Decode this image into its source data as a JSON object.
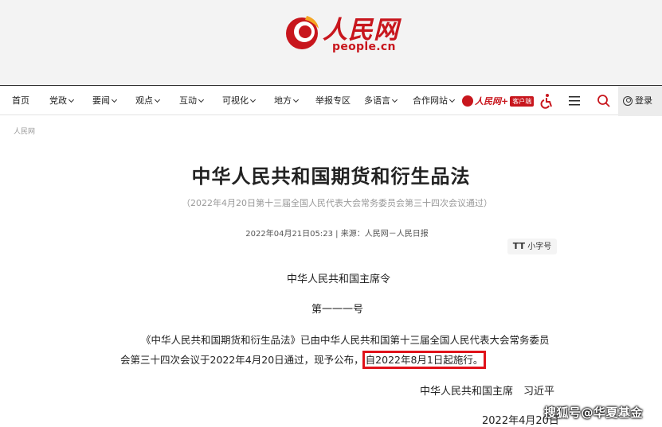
{
  "site": {
    "logo_cn": "人民网",
    "logo_url": "people.cn",
    "brand_color": "#c8161d"
  },
  "nav": {
    "items": [
      {
        "label": "首页",
        "has_dropdown": false
      },
      {
        "label": "党政",
        "has_dropdown": true
      },
      {
        "label": "要闻",
        "has_dropdown": true
      },
      {
        "label": "观点",
        "has_dropdown": true
      },
      {
        "label": "互动",
        "has_dropdown": true
      },
      {
        "label": "可视化",
        "has_dropdown": true
      },
      {
        "label": "地方",
        "has_dropdown": true
      },
      {
        "label": "举报专区",
        "has_dropdown": false
      },
      {
        "label": "多语言",
        "has_dropdown": true
      },
      {
        "label": "合作网站",
        "has_dropdown": true
      }
    ],
    "promo_text": "人民网+",
    "promo_badge": "客户端",
    "icons": [
      "accessibility-icon",
      "menu-icon",
      "search-icon"
    ],
    "login_label": "登录"
  },
  "article": {
    "breadcrumb": "人民网",
    "title": "中华人民共和国期货和衍生品法",
    "subtitle": "（2022年4月20日第十三届全国人民代表大会常务委员会第三十四次会议通过）",
    "meta": "2022年04月21日05:23 | 来源：人民网－人民日报",
    "fontsize_button": "小字号",
    "fontsize_icon_text": "TT",
    "order_title": "中华人民共和国主席令",
    "order_number": "第一一一号",
    "body_line1": "《中华人民共和国期货和衍生品法》已由中华人民共和国第十三届全国人民代表大会常务委员",
    "body_line2": "会第三十四次会议于2022年4月20日通过，现予公布，",
    "body_highlight": "自2022年8月1日起施行。",
    "signature": "中华人民共和国主席　习近平",
    "date_line": "2022年4月20日"
  },
  "watermark": "搜狐号@华夏基金"
}
